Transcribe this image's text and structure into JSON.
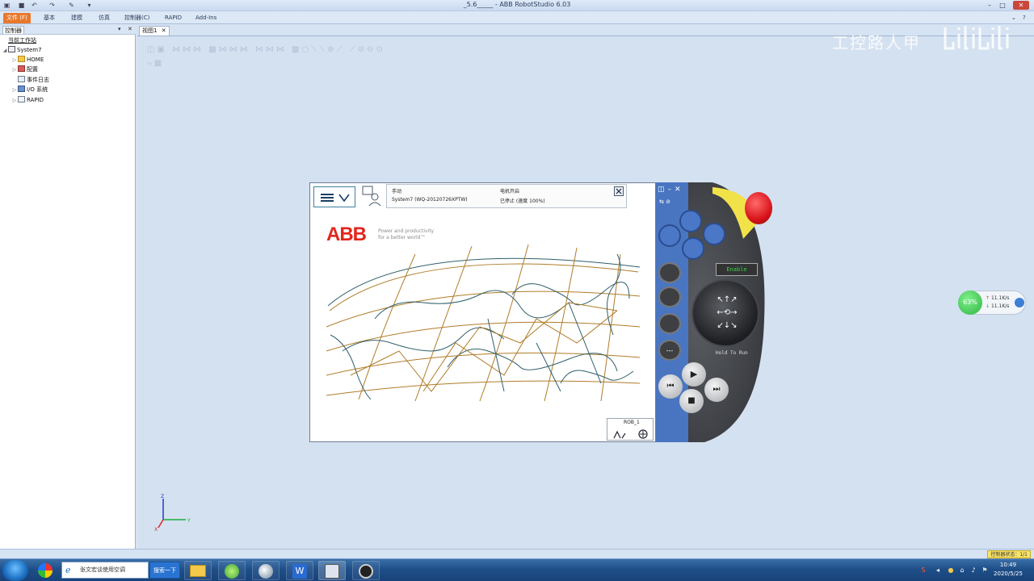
{
  "window": {
    "title": "_5.6_____ - ABB RobotStudio 6.03",
    "controls": [
      "minimize-icon",
      "maximize-icon",
      "close-icon"
    ]
  },
  "ribbon": {
    "tabs": [
      "文件 (F)",
      "基本",
      "建模",
      "仿真",
      "控制器(C)",
      "RAPID",
      "Add-Ins"
    ]
  },
  "left_panel": {
    "tab_label": "控制器",
    "tree": [
      {
        "label": "当前工作站",
        "level": 0,
        "icon": "station-icon"
      },
      {
        "label": "System7",
        "level": 0,
        "icon": "controller-icon"
      },
      {
        "label": "HOME",
        "level": 1,
        "icon": "folder-icon"
      },
      {
        "label": "配置",
        "level": 1,
        "icon": "config-icon"
      },
      {
        "label": "事件日志",
        "level": 1,
        "icon": "log-icon"
      },
      {
        "label": "I/O 系统",
        "level": 1,
        "icon": "io-icon"
      },
      {
        "label": "RAPID",
        "level": 1,
        "icon": "rapid-icon"
      }
    ]
  },
  "document": {
    "tab_label": "视图1"
  },
  "watermark": {
    "text": "工控路人甲"
  },
  "pendant": {
    "mode": "手动",
    "system": "System7 (WQ-20120726XPTW)",
    "motors": "电机开启",
    "state": "已停止 (速度 100%)",
    "slogan_line1": "Power and productivity",
    "slogan_line2": "for a better world™",
    "logo": "ABB",
    "rob_label": "ROB_1",
    "enable_label": "Enable",
    "hold_label": "Hold To Run"
  },
  "network": {
    "percent": "63%",
    "up": "11.1K/s",
    "down": "11.1K/s"
  },
  "axes": {
    "z": "Z",
    "y": "Y",
    "x": "X"
  },
  "status_bar": {
    "controller_status": "控制器状态：1/1"
  },
  "taskbar": {
    "search_value": "张文宏谈使用空调",
    "search_button": "搜索一下",
    "time": "10:49",
    "date": "2020/5/25"
  },
  "colors": {
    "abb_red": "#e2261d",
    "pendant_blue": "#4a78c7",
    "estop_red": "#e0272b",
    "enable_green": "#39d14a"
  }
}
